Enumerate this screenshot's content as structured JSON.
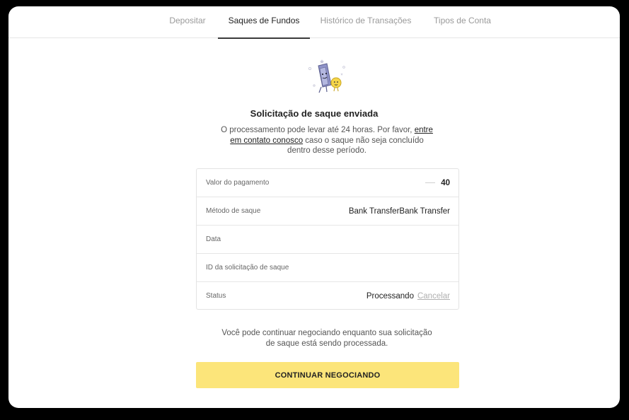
{
  "tabs": [
    {
      "label": "Depositar",
      "active": false
    },
    {
      "label": "Saques de Fundos",
      "active": true
    },
    {
      "label": "Histórico de Transações",
      "active": false
    },
    {
      "label": "Tipos de Conta",
      "active": false
    }
  ],
  "illustration": {
    "icon": "banknote-and-coin-icon",
    "colors": {
      "note": "#8f93c9",
      "coin": "#f6d64a"
    }
  },
  "confirmation": {
    "title": "Solicitação de saque enviada",
    "desc_before": "O processamento pode levar até 24 horas. Por favor, ",
    "desc_link": "entre em contato conosco",
    "desc_after": " caso o saque não seja concluído dentro desse período."
  },
  "details": {
    "amount_label": "Valor do pagamento",
    "amount_value": "40",
    "method_label": "Método de saque",
    "method_value": "Bank TransferBank Transfer",
    "date_label": "Data",
    "date_value": "",
    "request_id_label": "ID da solicitação de saque",
    "request_id_value": "",
    "status_label": "Status",
    "status_value": "Processando",
    "cancel_label": "Cancelar"
  },
  "footer_note": "Você pode continuar negociando enquanto sua solicitação de saque está sendo processada.",
  "cta_label": "CONTINUAR NEGOCIANDO",
  "colors": {
    "accent": "#fce57a",
    "active_tab_underline": "#3a3a3a"
  }
}
